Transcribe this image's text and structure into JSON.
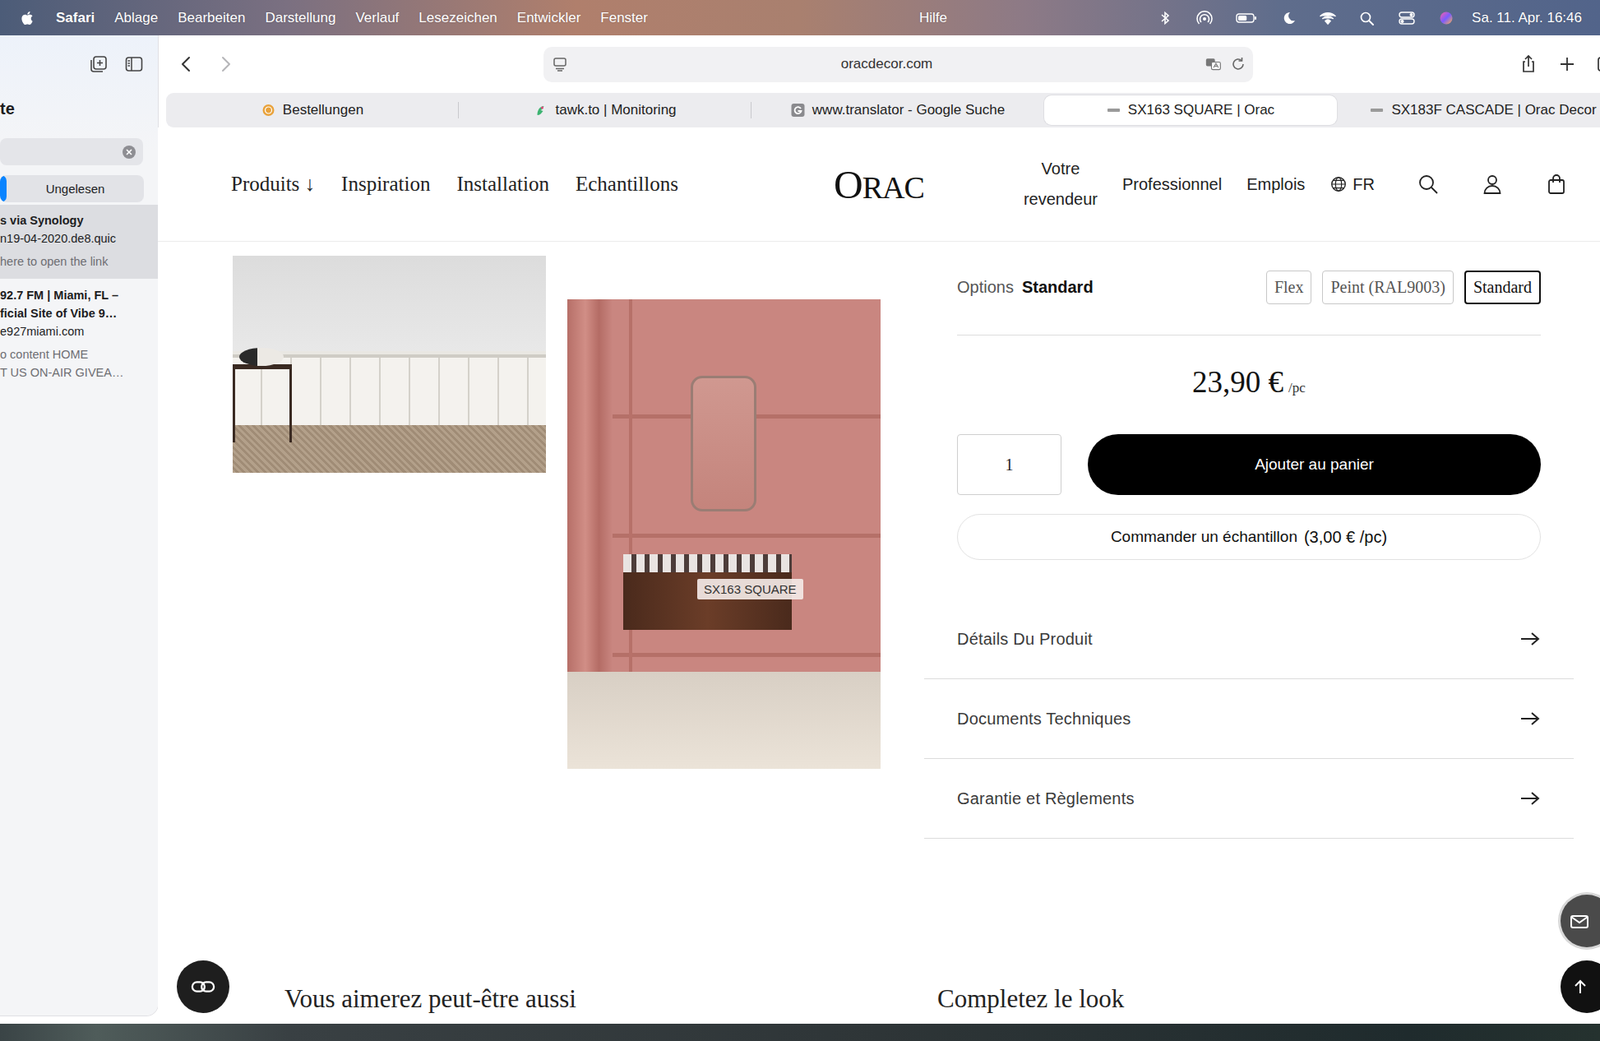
{
  "menubar": {
    "app": "Safari",
    "menus": [
      "Ablage",
      "Bearbeiten",
      "Darstellung",
      "Verlauf",
      "Lesezeichen",
      "Entwickler",
      "Fenster"
    ],
    "help": "Hilfe",
    "battery": {
      "level": 0.6
    },
    "clock": "Sa. 11. Apr. 16:46"
  },
  "sidebar": {
    "title": "te",
    "search": {
      "value": ""
    },
    "segments": [
      {
        "label": "",
        "selected": true
      },
      {
        "label": "Ungelesen",
        "selected": false
      }
    ],
    "items": [
      {
        "title_lines": [
          "s via Synology"
        ],
        "url": "n19-04-2020.de8.quic",
        "snippet_lines": [
          "here to open the link"
        ],
        "selected": true
      },
      {
        "title_lines": [
          "92.7 FM | Miami, FL –",
          "ficial Site of Vibe 9…"
        ],
        "url": "e927miami.com",
        "snippet_lines": [
          "o content HOME",
          "T US ON-AIR GIVEA…"
        ],
        "selected": false
      }
    ]
  },
  "toolbar": {
    "url": "oracdecor.com"
  },
  "tabs": [
    {
      "label": "Bestellungen",
      "kind": "orders",
      "selected": false
    },
    {
      "label": "tawk.to | Monitoring",
      "kind": "tawk",
      "selected": false
    },
    {
      "label": "www.translator - Google Suche",
      "kind": "google",
      "selected": false
    },
    {
      "label": "SX163 SQUARE | Orac",
      "kind": "orac",
      "selected": true
    },
    {
      "label": "SX183F CASCADE | Orac Decor",
      "kind": "orac",
      "selected": false
    }
  ],
  "site_header": {
    "nav": [
      "Produits ↓",
      "Inspiration",
      "Installation",
      "Echantillons"
    ],
    "logo": "ORAC",
    "dealer_lines": [
      "Votre",
      "revendeur"
    ],
    "links": [
      "Professionnel",
      "Emplois"
    ],
    "language": "FR"
  },
  "gallery": {
    "tag": "SX163 SQUARE"
  },
  "product": {
    "options": {
      "label": "Options",
      "value": "Standard",
      "choices": [
        {
          "label": "Flex",
          "selected": false
        },
        {
          "label": "Peint (RAL9003)",
          "selected": false
        },
        {
          "label": "Standard",
          "selected": true
        }
      ]
    },
    "price": "23,90 €",
    "unit": "/pc",
    "quantity": "1",
    "add_button": "Ajouter au panier",
    "sample": {
      "label": "Commander un échantillon",
      "price": "(3,00 € /pc)"
    },
    "accordion": [
      "Détails Du Produit",
      "Documents Techniques",
      "Garantie et Règlements"
    ]
  },
  "sections": [
    "Vous aimerez peut-être aussi",
    "Completez le look"
  ]
}
